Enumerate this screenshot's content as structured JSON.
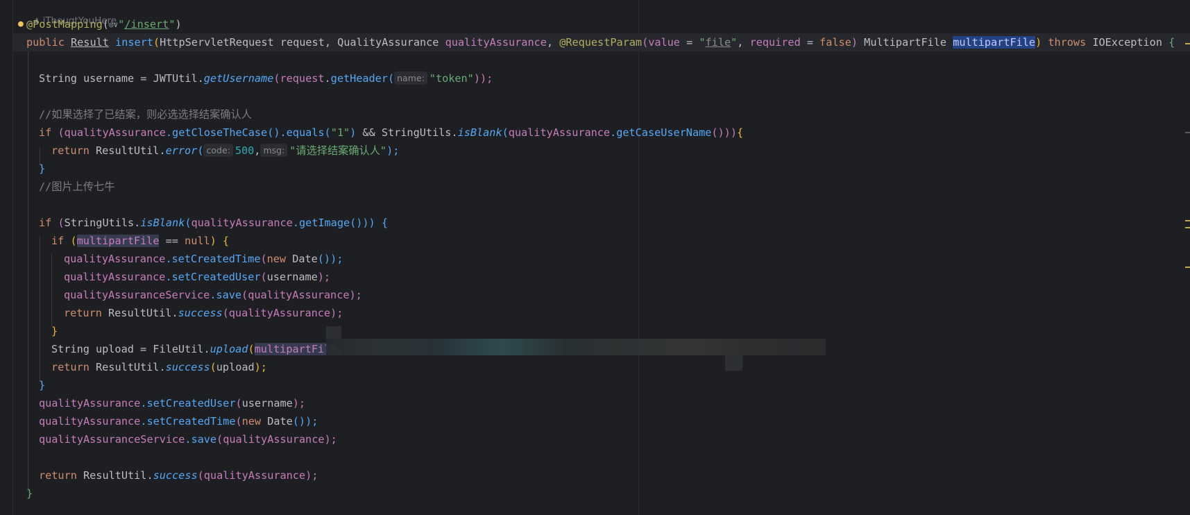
{
  "editor": {
    "author_hint": "iThougtYouHere",
    "author_icon": "person-icon",
    "intention_icon": "lightbulb-icon",
    "lines": {
      "l1": {
        "at": "@",
        "ann": "PostMapping",
        "open": "(",
        "badge": "◎∨",
        "q1": "\"",
        "path": "/insert",
        "q2": "\"",
        "close": ")"
      },
      "l2": {
        "kw_public": "public ",
        "type_result": "Result",
        "sp1": " ",
        "method": "insert",
        "open": "(",
        "t1": "HttpServletRequest ",
        "p1": "request",
        "c1": ", ",
        "t2": "QualityAssurance ",
        "p2": "qualityAssurance",
        "c2": ", ",
        "ann": "@RequestParam",
        "aopen": "(",
        "a_value": "value",
        "eq1": " = ",
        "q1": "\"",
        "file": "file",
        "q2": "\"",
        "c3": ", ",
        "a_req": "required",
        "eq2": " = ",
        "kw_false": "false",
        "aclose": ")",
        "t3": " MultipartFile ",
        "p3": "multipartFile",
        "close": ")",
        "kw_throws": " throws",
        "exc": " IOException ",
        "brace": "{"
      },
      "l3": {
        "t": "String username = JWTUtil.",
        "fn": "getUsername",
        "o1": "(",
        "req": "request",
        "dot": ".",
        "fn2": "getHeader",
        "o2": "(",
        "hint": "name:",
        "str": "\"token\"",
        "close": "));"
      },
      "l4": {
        "cmt": "//如果选择了已结案，则必选选择结案确认人"
      },
      "l5": {
        "kw": "if ",
        "o": "(",
        "qa": "qualityAssurance",
        "m1": ".getCloseTheCase",
        "o2": "()",
        "m2": ".equals",
        "o3": "(",
        "str": "\"1\"",
        "c3": ")",
        "and": " && StringUtils.",
        "fn": "isBlank",
        "o4": "(",
        "qa2": "qualityAssurance",
        "m3": ".getCaseUserName",
        "c4": "()))",
        "brace": "{"
      },
      "l6": {
        "kw": "return ",
        "t": "ResultUtil.",
        "fn": "error",
        "o": "(",
        "hint1": "code:",
        "num": "500",
        "comma": ",",
        "hint2": "msg:",
        "str": "\"请选择结案确认人\"",
        "close": ");"
      },
      "l7": {
        "brace": "}"
      },
      "l8": {
        "cmt": "//图片上传七牛"
      },
      "l9": {
        "kw": "if ",
        "o": "(",
        "t": "StringUtils.",
        "fn": "isBlank",
        "o2": "(",
        "qa": "qualityAssurance",
        "m": ".getImage",
        "c": "())) ",
        "brace": "{"
      },
      "l10": {
        "kw": "if ",
        "o": "(",
        "var": "multipartFile",
        "op": " == ",
        "kw_null": "null",
        "c": ") ",
        "brace": "{"
      },
      "l11": {
        "qa": "qualityAssurance",
        "m": ".setCreatedTime",
        "o": "(",
        "kw_new": "new ",
        "t": "Date",
        "c": "());"
      },
      "l12": {
        "qa": "qualityAssurance",
        "m": ".setCreatedUser",
        "o": "(",
        "t": "username",
        "c": ");"
      },
      "l13": {
        "qa": "qualityAssuranceService",
        "m": ".save",
        "o": "(",
        "qa2": "qualityAssurance",
        "c": ");"
      },
      "l14": {
        "kw": "return ",
        "t": "ResultUtil.",
        "fn": "success",
        "o": "(",
        "qa": "qualityAssurance",
        "c": ");"
      },
      "l15": {
        "brace": "}"
      },
      "l16": {
        "t": "String upload = FileUtil.",
        "fn": "upload",
        "o": "(",
        "var": "multipartFile",
        "c": ","
      },
      "l17": {
        "kw": "return ",
        "t": "ResultUtil.",
        "fn": "success",
        "o": "(",
        "v": "upload",
        "c": ");"
      },
      "l18": {
        "brace": "}"
      },
      "l19": {
        "qa": "qualityAssurance",
        "m": ".setCreatedUser",
        "o": "(",
        "t": "username",
        "c": ");"
      },
      "l20": {
        "qa": "qualityAssurance",
        "m": ".setCreatedTime",
        "o": "(",
        "kw_new": "new ",
        "t": "Date",
        "c": "());"
      },
      "l21": {
        "qa": "qualityAssuranceService",
        "m": ".save",
        "o": "(",
        "qa2": "qualityAssurance",
        "c": ");"
      },
      "l22": {
        "kw": "return ",
        "t": "ResultUtil.",
        "fn": "success",
        "o": "(",
        "qa": "qualityAssurance",
        "c": ");"
      },
      "l23": {
        "brace": "}"
      }
    },
    "colors": {
      "background": "#1e1f22",
      "keyword": "#cf8e6d",
      "annotation": "#b3ae60",
      "string": "#6aab73",
      "number": "#2aacb8",
      "field": "#c77dbb",
      "method": "#56a8f5",
      "comment": "#7a7e85",
      "selection": "#214283"
    }
  }
}
